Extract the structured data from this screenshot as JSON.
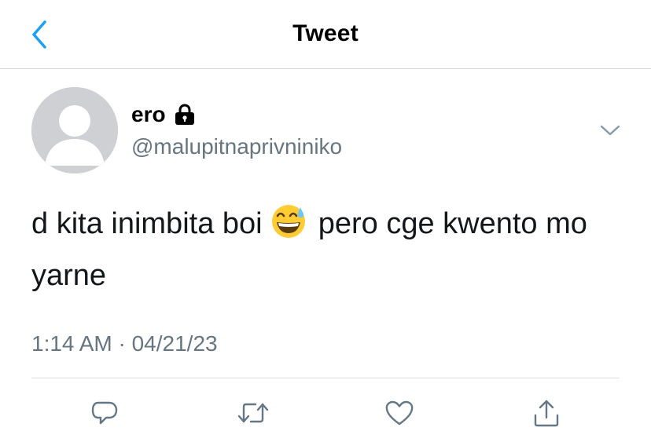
{
  "header": {
    "title": "Tweet",
    "back_icon": "chevron-left-icon",
    "accent_color": "#1da1f2"
  },
  "tweet": {
    "author": {
      "name": "ero",
      "handle": "@malupitnaprivniniko",
      "protected_icon": "lock-icon"
    },
    "text_before_emoji": "d kita inimbita boi",
    "emoji": "grinning-face-with-sweat-emoji",
    "text_after_emoji": "pero cge kwento mo yarne",
    "timestamp": "1:14 AM · 04/21/23"
  },
  "actions": {
    "reply_icon": "reply-icon",
    "retweet_icon": "retweet-icon",
    "like_icon": "heart-icon",
    "share_icon": "share-icon",
    "icon_color": "#657786"
  }
}
